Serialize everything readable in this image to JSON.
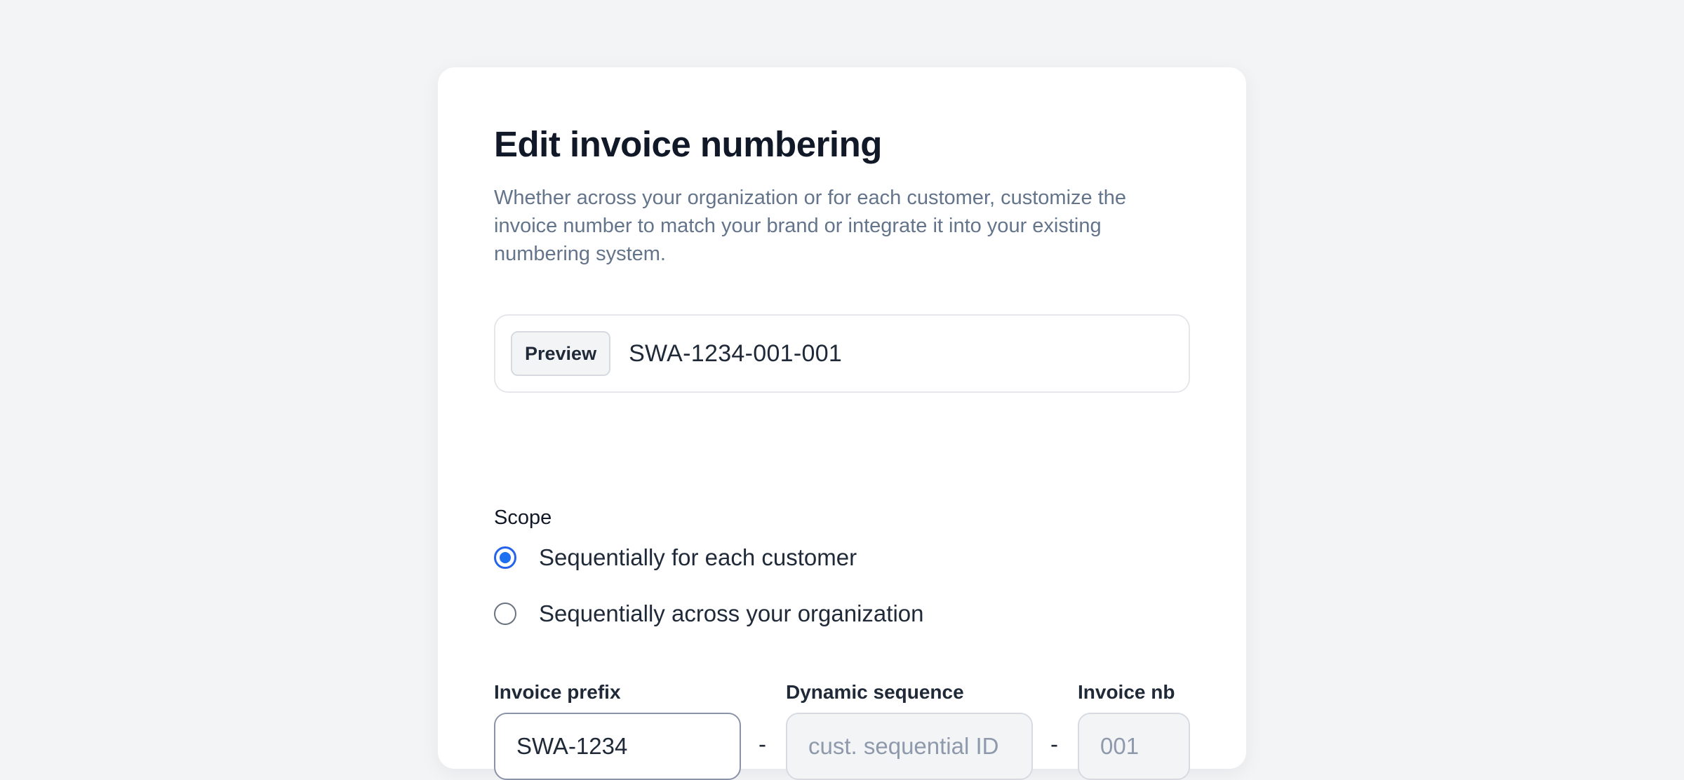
{
  "modal": {
    "title": "Edit invoice numbering",
    "description": "Whether across your organization or for each customer, customize the invoice number to match your brand or integrate it into your existing numbering system."
  },
  "preview": {
    "badge": "Preview",
    "value": "SWA-1234-001-001"
  },
  "scope": {
    "label": "Scope",
    "options": [
      {
        "label": "Sequentially for each customer",
        "selected": true
      },
      {
        "label": "Sequentially across your organization",
        "selected": false
      }
    ]
  },
  "fields": {
    "prefix": {
      "label": "Invoice prefix",
      "value": "SWA-1234"
    },
    "separator": "-",
    "dynamic": {
      "label": "Dynamic sequence",
      "placeholder": "cust. sequential ID"
    },
    "number": {
      "label": "Invoice nb",
      "placeholder": "001"
    }
  },
  "colors": {
    "accent": "#1d6ef0",
    "page_background": "#f3f4f6",
    "muted_text": "#64748b"
  }
}
